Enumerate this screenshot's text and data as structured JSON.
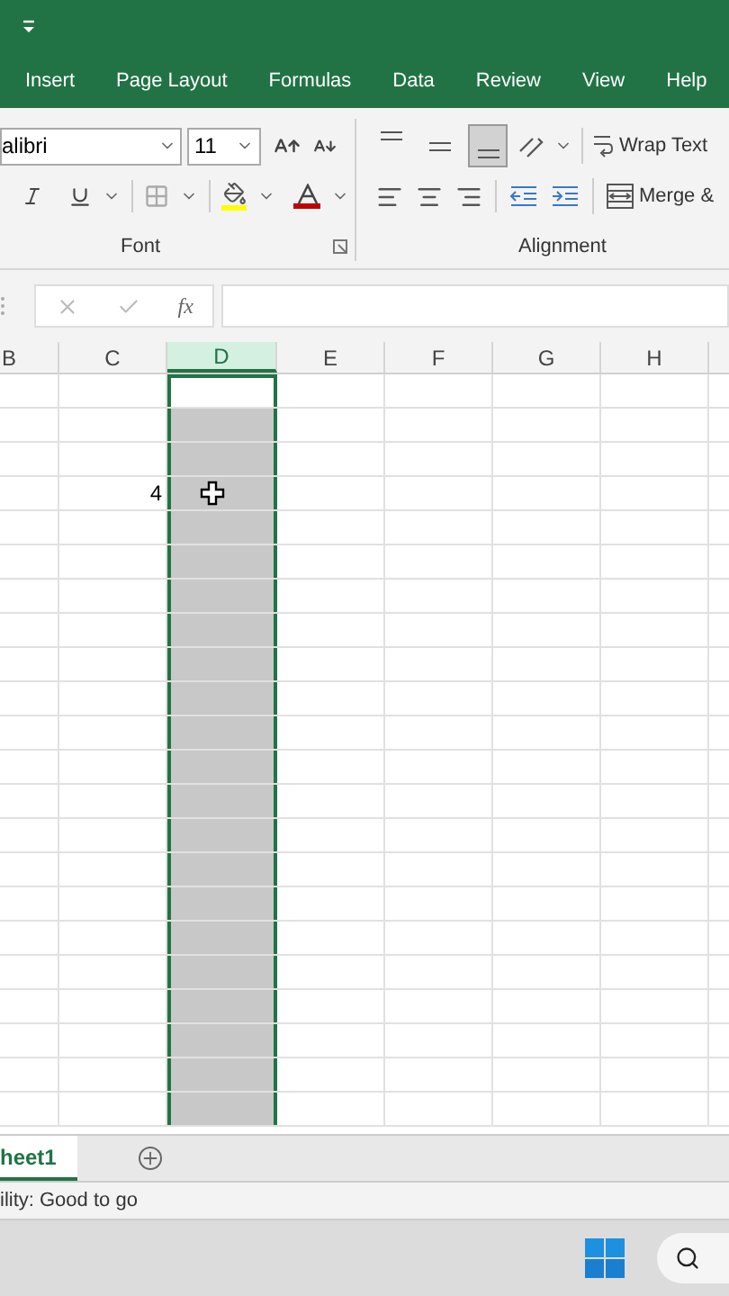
{
  "tabs": [
    {
      "label": "Insert",
      "selected": false
    },
    {
      "label": "Page Layout",
      "selected": false
    },
    {
      "label": "Formulas",
      "selected": false
    },
    {
      "label": "Data",
      "selected": false
    },
    {
      "label": "Review",
      "selected": false
    },
    {
      "label": "View",
      "selected": false
    },
    {
      "label": "Help",
      "selected": false
    }
  ],
  "font_group": {
    "font_name": "alibri",
    "font_size": "11",
    "label": "Font"
  },
  "alignment_group": {
    "vertical_align": [
      {
        "kind": "top",
        "selected": false
      },
      {
        "kind": "middle",
        "selected": false
      },
      {
        "kind": "bottom",
        "selected": true
      }
    ],
    "wrap_text": "Wrap Text",
    "merge": "Merge &",
    "label": "Alignment"
  },
  "formula_bar": {
    "fx": "fx"
  },
  "columns": [
    {
      "label": "B",
      "selected": false
    },
    {
      "label": "C",
      "selected": false
    },
    {
      "label": "D",
      "selected": true
    },
    {
      "label": "E",
      "selected": false
    },
    {
      "label": "F",
      "selected": false
    },
    {
      "label": "G",
      "selected": false
    },
    {
      "label": "H",
      "selected": false
    }
  ],
  "rows": [
    {
      "active": true
    },
    {
      "active": false
    },
    {
      "active": false
    },
    {
      "active": false,
      "column_c": "4"
    },
    {
      "active": false
    },
    {
      "active": false
    },
    {
      "active": false
    },
    {
      "active": false
    },
    {
      "active": false
    },
    {
      "active": false
    },
    {
      "active": false
    },
    {
      "active": false
    },
    {
      "active": false
    },
    {
      "active": false
    },
    {
      "active": false
    },
    {
      "active": false
    },
    {
      "active": false
    },
    {
      "active": false
    },
    {
      "active": false
    },
    {
      "active": false
    },
    {
      "active": false
    },
    {
      "active": false
    }
  ],
  "sheets": [
    {
      "label": "heet1",
      "selected": true
    }
  ],
  "status_bar": {
    "text": "ility: Good to go"
  }
}
